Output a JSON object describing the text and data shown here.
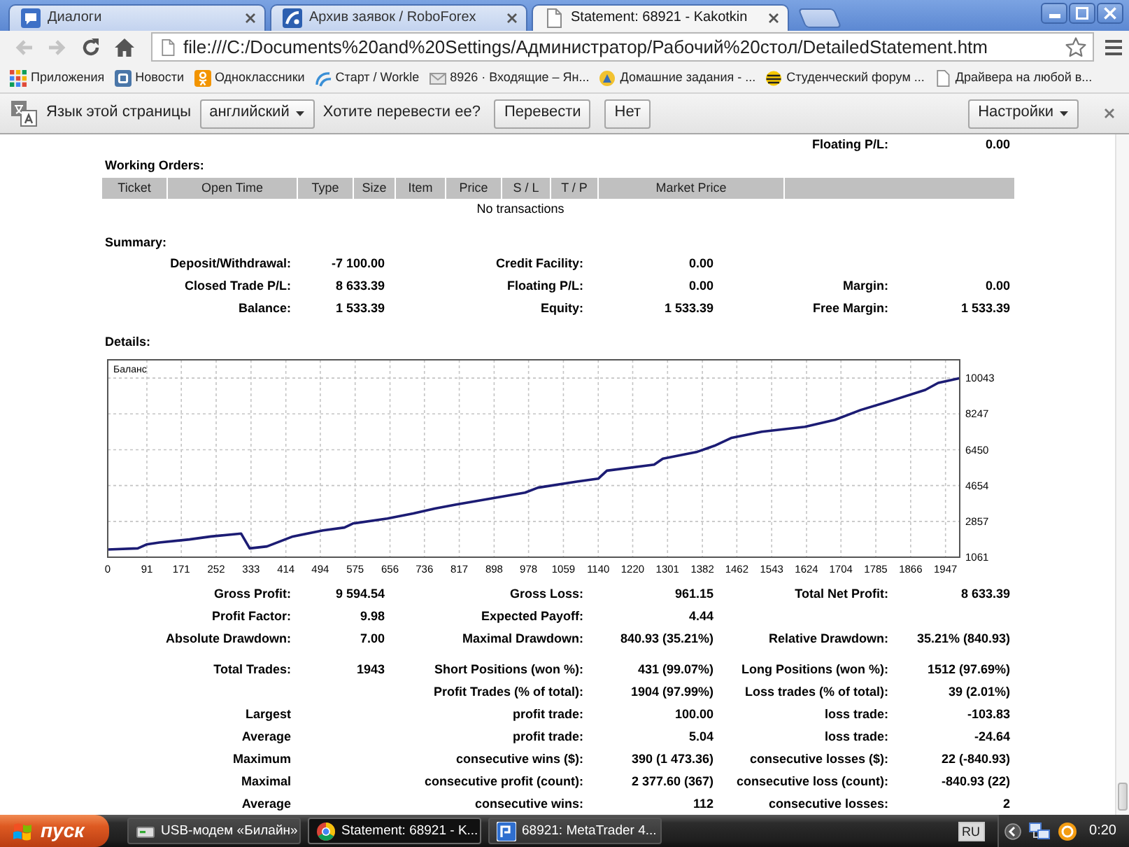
{
  "browser": {
    "tabs": [
      {
        "kind": "chat",
        "title": "Диалоги",
        "selected": false
      },
      {
        "kind": "logo",
        "title": "Архив заявок / RoboForex",
        "selected": false
      },
      {
        "kind": "page",
        "title": "Statement: 68921 - Kakotkin",
        "selected": true
      }
    ],
    "nav_buttons": [
      {
        "kind": "back",
        "disabled": true
      },
      {
        "kind": "forward",
        "disabled": true
      },
      {
        "kind": "reload",
        "disabled": false
      },
      {
        "kind": "home",
        "disabled": false
      }
    ],
    "address": "file:///C:/Documents%20and%20Settings/Администратор/Рабочий%20стол/DetailedStatement.htm",
    "bookmarks": [
      {
        "kind": "apps",
        "label": "Приложения"
      },
      {
        "kind": "tile",
        "label": "Новости"
      },
      {
        "kind": "person",
        "label": "Одноклассники"
      },
      {
        "kind": "swirl",
        "label": "Старт / Workle"
      },
      {
        "kind": "envelope",
        "label": "8926 · Входящие – Ян..."
      },
      {
        "kind": "emblem",
        "label": "Домашние задания - ..."
      },
      {
        "kind": "ball",
        "label": "Студенческий форум ..."
      },
      {
        "kind": "page",
        "label": "Драйвера на любой в..."
      }
    ],
    "translate_bar": {
      "prompt": "Язык этой страницы",
      "language": "английский",
      "question": "Хотите перевести ее?",
      "translate": "Перевести",
      "decline": "Нет",
      "settings": "Настройки"
    }
  },
  "statement": {
    "account_rows": [
      {
        "right": {
          "label": "Floating P/L:",
          "value": "0.00"
        }
      }
    ],
    "working_orders": {
      "title": "Working Orders:",
      "columns": [
        "Ticket",
        "Open Time",
        "Type",
        "Size",
        "Item",
        "Price",
        "S / L",
        "T / P",
        "Market Price"
      ],
      "empty_text": "No transactions"
    },
    "summary": {
      "title": "Summary:",
      "rows": [
        {
          "left": {
            "label": "Deposit/Withdrawal:",
            "value": "-7 100.00"
          },
          "middle": {
            "label": "Credit Facility:",
            "value": "0.00"
          }
        },
        {
          "left": {
            "label": "Closed Trade P/L:",
            "value": "8 633.39"
          },
          "middle": {
            "label": "Floating P/L:",
            "value": "0.00"
          },
          "right": {
            "label": "Margin:",
            "value": "0.00"
          }
        },
        {
          "left": {
            "label": "Balance:",
            "value": "1 533.39"
          },
          "middle": {
            "label": "Equity:",
            "value": "1 533.39"
          },
          "right": {
            "label": "Free Margin:",
            "value": "1 533.39"
          }
        }
      ]
    },
    "details": {
      "title": "Details:",
      "chart_data": {
        "type": "line",
        "grid": true,
        "xlim": [
          0,
          1980
        ],
        "ylim": [
          1061,
          10960
        ],
        "xticks": [
          0,
          91,
          171,
          252,
          333,
          414,
          494,
          575,
          656,
          736,
          817,
          898,
          978,
          1059,
          1140,
          1220,
          1301,
          1382,
          1462,
          1543,
          1624,
          1704,
          1785,
          1866,
          1947
        ],
        "yticks": [
          1061,
          2857,
          4654,
          6450,
          8247,
          10043
        ],
        "x": [
          0,
          70,
          90,
          120,
          190,
          240,
          310,
          330,
          370,
          430,
          500,
          550,
          570,
          650,
          710,
          760,
          810,
          890,
          970,
          1000,
          1090,
          1140,
          1160,
          1270,
          1290,
          1370,
          1410,
          1450,
          1520,
          1620,
          1690,
          1750,
          1820,
          1900,
          1930,
          1980
        ],
        "series": [
          {
            "name": "Баланс",
            "color": "#1c1c74",
            "values": [
              1450,
              1500,
              1700,
              1800,
              1950,
              2100,
              2250,
              1500,
              1600,
              2100,
              2400,
              2550,
              2750,
              3000,
              3250,
              3500,
              3700,
              4000,
              4300,
              4550,
              4850,
              5000,
              5400,
              5700,
              6000,
              6350,
              6650,
              7050,
              7350,
              7600,
              7950,
              8450,
              8900,
              9450,
              9800,
              10043
            ]
          }
        ]
      },
      "groups": [
        [
          {
            "left": {
              "label": "Gross Profit:",
              "value": "9 594.54"
            },
            "middle": {
              "label": "Gross Loss:",
              "value": "961.15"
            },
            "right": {
              "label": "Total Net Profit:",
              "value": "8 633.39"
            }
          },
          {
            "left": {
              "label": "Profit Factor:",
              "value": "9.98"
            },
            "middle": {
              "label": "Expected Payoff:",
              "value": "4.44"
            }
          },
          {
            "left": {
              "label": "Absolute Drawdown:",
              "value": "7.00"
            },
            "middle": {
              "label": "Maximal Drawdown:",
              "value": "840.93 (35.21%)"
            },
            "right": {
              "label": "Relative Drawdown:",
              "value": "35.21% (840.93)"
            }
          }
        ],
        [
          {
            "left": {
              "label": "Total Trades:",
              "value": "1943"
            },
            "middle": {
              "label": "Short Positions (won %):",
              "value": "431 (99.07%)"
            },
            "right": {
              "label": "Long Positions (won %):",
              "value": "1512 (97.69%)"
            }
          },
          {
            "middle": {
              "label": "Profit Trades (% of total):",
              "value": "1904 (97.99%)"
            },
            "right": {
              "label": "Loss trades (% of total):",
              "value": "39 (2.01%)"
            }
          },
          {
            "left": {
              "label": "Largest"
            },
            "middle": {
              "label": "profit trade:",
              "value": "100.00"
            },
            "right": {
              "label": "loss trade:",
              "value": "-103.83"
            }
          },
          {
            "left": {
              "label": "Average"
            },
            "middle": {
              "label": "profit trade:",
              "value": "5.04"
            },
            "right": {
              "label": "loss trade:",
              "value": "-24.64"
            }
          },
          {
            "left": {
              "label": "Maximum"
            },
            "middle": {
              "label": "consecutive wins ($):",
              "value": "390 (1 473.36)"
            },
            "right": {
              "label": "consecutive losses ($):",
              "value": "22 (-840.93)"
            }
          },
          {
            "left": {
              "label": "Maximal"
            },
            "middle": {
              "label": "consecutive profit (count):",
              "value": "2 377.60 (367)"
            },
            "right": {
              "label": "consecutive loss (count):",
              "value": "-840.93 (22)"
            }
          },
          {
            "left": {
              "label": "Average"
            },
            "middle": {
              "label": "consecutive wins:",
              "value": "112"
            },
            "right": {
              "label": "consecutive losses:",
              "value": "2"
            }
          }
        ]
      ]
    }
  },
  "taskbar": {
    "start": "пуск",
    "items": [
      {
        "kind": "modem",
        "label": "USB-модем «Билайн»",
        "selected": false
      },
      {
        "kind": "browser",
        "label": "Statement: 68921 - K...",
        "selected": true
      },
      {
        "kind": "terminal",
        "label": "68921: MetaTrader 4...",
        "selected": false
      }
    ],
    "language": "RU",
    "clock": "0:20"
  }
}
